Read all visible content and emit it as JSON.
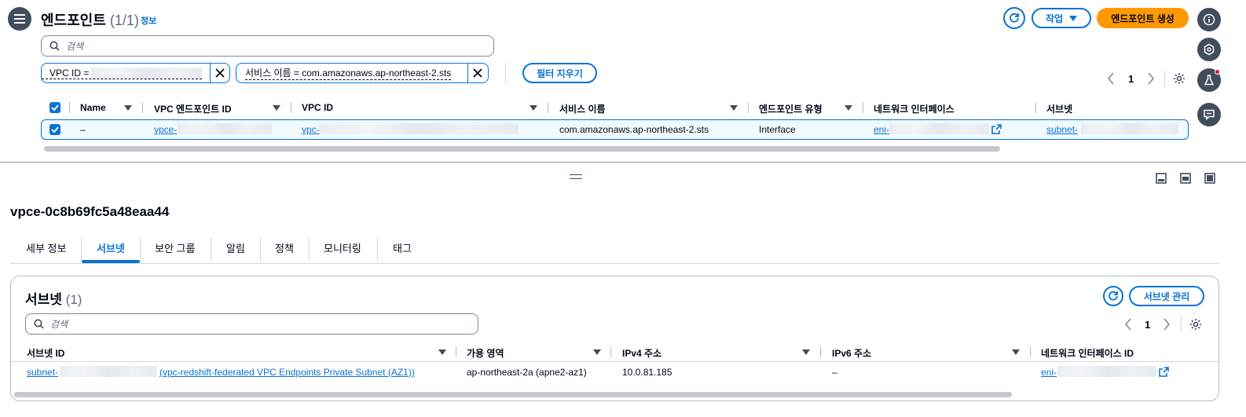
{
  "header": {
    "title": "엔드포인트",
    "count": "(1/1)",
    "info_link": "정보",
    "actions_label": "작업",
    "create_label": "엔드포인트 생성"
  },
  "search": {
    "placeholder": "검색"
  },
  "filters": {
    "token1_label": "VPC ID = ",
    "token2_label": "서비스 이름 = com.amazonaws.ap-northeast-2.sts",
    "clear_label": "필터 지우기"
  },
  "pagination": {
    "page": "1"
  },
  "table": {
    "headers": [
      "Name",
      "VPC 엔드포인트 ID",
      "VPC ID",
      "서비스 이름",
      "엔드포인트 유형",
      "네트워크 인터페이스",
      "서브넷"
    ],
    "row": {
      "name": "–",
      "endpoint_id": "vpce-",
      "vpc_id": "vpc-",
      "service": "com.amazonaws.ap-northeast-2.sts",
      "type": "Interface",
      "eni": "eni-",
      "subnet": "subnet-"
    }
  },
  "detail": {
    "title": "vpce-0c8b69fc5a48eaa44",
    "tabs": [
      "세부 정보",
      "서브넷",
      "보안 그룹",
      "알림",
      "정책",
      "모니터링",
      "태그"
    ]
  },
  "subnets": {
    "title": "서브넷",
    "count": "(1)",
    "manage_label": "서브넷 관리",
    "search_placeholder": "검색",
    "page": "1",
    "headers": [
      "서브넷 ID",
      "가용 영역",
      "IPv4 주소",
      "IPv6 주소",
      "네트워크 인터페이스 ID"
    ],
    "row": {
      "subnet_prefix": "subnet-",
      "subnet_name": "(vpc-redshift-federated VPC Endpoints Private Subnet (AZ1))",
      "az": "ap-northeast-2a (apne2-az1)",
      "ipv4": "10.0.81.185",
      "ipv6": "–",
      "eni": "eni-"
    }
  },
  "colors": {
    "primary": "#ff9900",
    "link": "#0972d3",
    "dark": "#414d5c"
  }
}
